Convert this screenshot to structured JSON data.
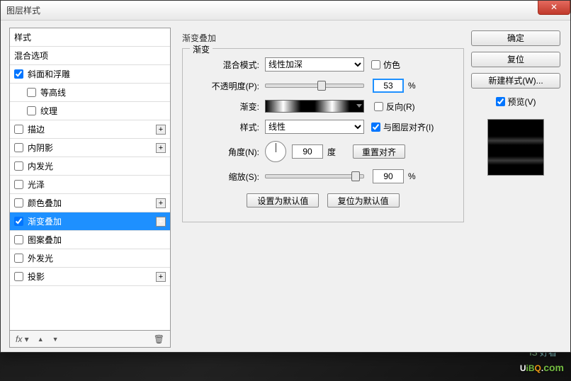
{
  "dialog": {
    "title": "图层样式",
    "close_glyph": "✕"
  },
  "styles_list": {
    "header": "样式",
    "blending": "混合选项",
    "bevel_emboss": "斜面和浮雕",
    "contour": "等高线",
    "texture": "纹理",
    "stroke": "描边",
    "inner_shadow": "内阴影",
    "inner_glow": "内发光",
    "satin": "光泽",
    "color_overlay": "颜色叠加",
    "gradient_overlay": "渐变叠加",
    "pattern_overlay": "图案叠加",
    "outer_glow": "外发光",
    "drop_shadow": "投影"
  },
  "footer": {
    "fx": "fx",
    "glyph_up": "▲",
    "glyph_down": "▼",
    "glyph_trash": "🗑"
  },
  "center": {
    "section_title": "渐变叠加",
    "fieldset_label": "渐变",
    "blend_mode_label": "混合模式:",
    "blend_mode_value": "线性加深",
    "dither_label": "仿色",
    "opacity_label": "不透明度(P):",
    "opacity_value": "53",
    "percent": "%",
    "gradient_label": "渐变:",
    "reverse_label": "反向(R)",
    "style_label": "样式:",
    "style_value": "线性",
    "align_label": "与图层对齐(I)",
    "angle_label": "角度(N):",
    "angle_value": "90",
    "angle_unit": "度",
    "reset_align": "重置对齐",
    "scale_label": "缩放(S):",
    "scale_value": "90",
    "set_default": "设置为默认值",
    "reset_default": "复位为默认值"
  },
  "right": {
    "ok": "确定",
    "cancel": "复位",
    "new_style": "新建样式(W)...",
    "preview_label": "预览(V)"
  },
  "watermark": {
    "sub": "好看",
    "logo_u": "U",
    "logo_i": "i",
    "logo_b": "B",
    "logo_q": "Q",
    "logo_dot": ".",
    "logo_com": "com"
  }
}
